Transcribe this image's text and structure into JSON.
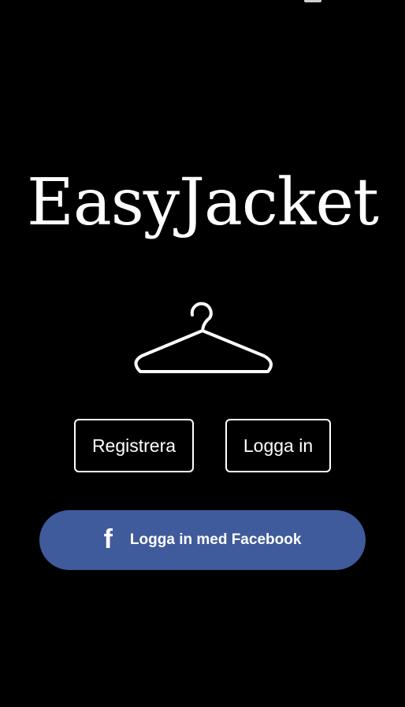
{
  "app": {
    "title": "EasyJacket"
  },
  "logo": {
    "icon": "hanger-icon"
  },
  "actions": {
    "register_label": "Registrera",
    "login_label": "Logga in",
    "facebook_label": "Logga in med Facebook",
    "facebook_icon": "f"
  },
  "colors": {
    "background": "#000000",
    "text": "#ffffff",
    "facebook": "#3f5b9c"
  }
}
